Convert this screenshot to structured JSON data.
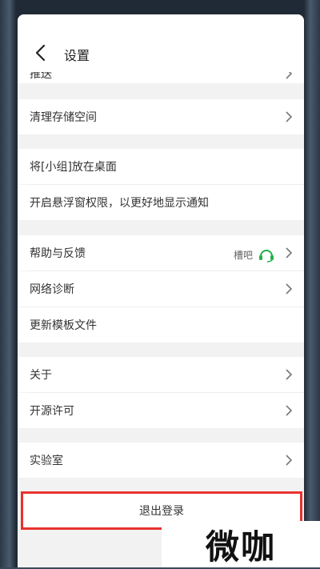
{
  "header": {
    "title": "设置"
  },
  "partial_row": {
    "label": "推送"
  },
  "sections": [
    [
      {
        "label": "清理存储空间",
        "chevron": true
      }
    ],
    [
      {
        "label": "将[小组]放在桌面",
        "chevron": false
      },
      {
        "label": "开启悬浮窗权限，以更好地显示通知",
        "chevron": false
      }
    ],
    [
      {
        "label": "帮助与反馈",
        "chevron": true,
        "aux_text": "槽吧",
        "aux_icon": "headset-icon"
      },
      {
        "label": "网络诊断",
        "chevron": true
      },
      {
        "label": "更新模板文件",
        "chevron": false
      }
    ],
    [
      {
        "label": "关于",
        "chevron": true
      },
      {
        "label": "开源许可",
        "chevron": true
      }
    ],
    [
      {
        "label": "实验室",
        "chevron": true
      }
    ]
  ],
  "logout": {
    "label": "退出登录"
  },
  "watermark": {
    "text": "微咖"
  },
  "colors": {
    "highlight": "#e8322e",
    "accent_green": "#22b14c",
    "background": "#f2f2f2"
  }
}
